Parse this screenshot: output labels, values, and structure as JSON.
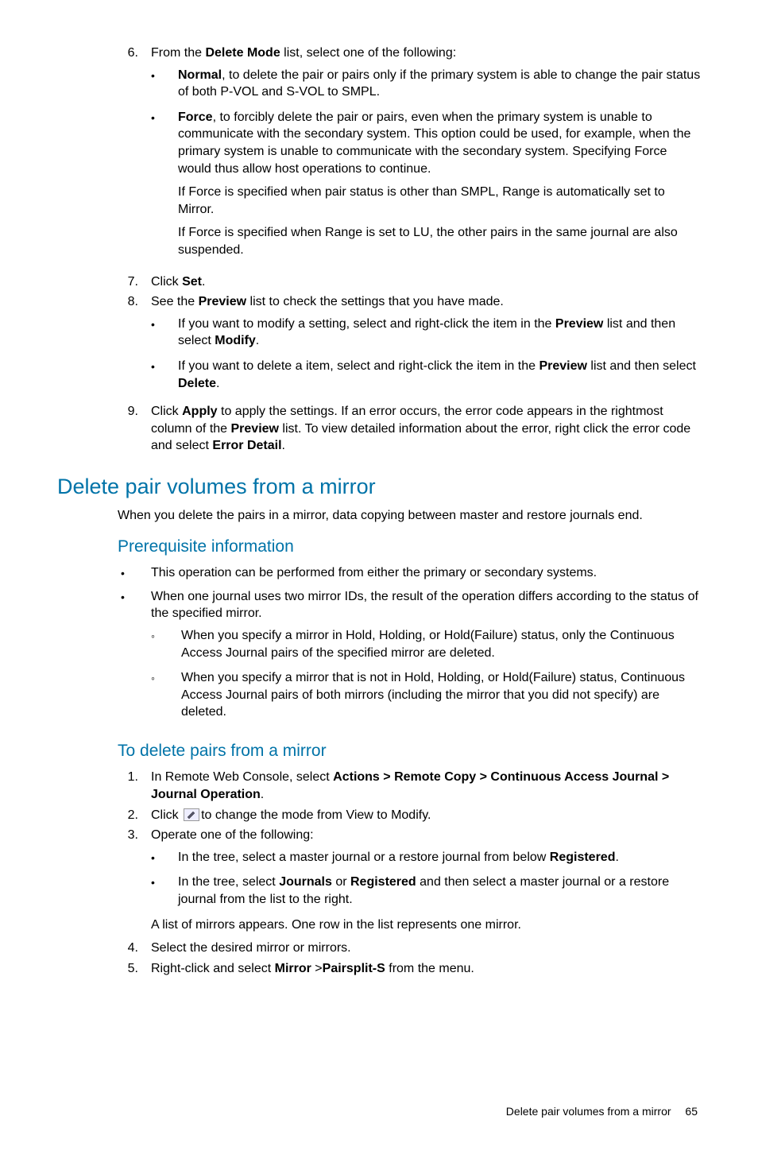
{
  "steps_a": {
    "n6": "6.",
    "s6_lead": "From the ",
    "s6_b": "Delete Mode",
    "s6_tail": " list, select one of the following:",
    "s6_b1_b": "Normal",
    "s6_b1_t": ", to delete the pair or pairs only if the primary system is able to change the pair status of both P-VOL and S-VOL to SMPL.",
    "s6_b2_b": "Force",
    "s6_b2_t": ", to forcibly delete the pair or pairs, even when the primary system is unable to communicate with the secondary system. This option could be used, for example, when the primary system is unable to communicate with the secondary system. Specifying Force would thus allow host operations to continue.",
    "s6_b2_p2": "If Force is specified when pair status is other than SMPL, Range is automatically set to Mirror.",
    "s6_b2_p3": "If Force is specified when Range is set to LU, the other pairs in the same journal are also suspended.",
    "n7": "7.",
    "s7_lead": "Click ",
    "s7_b": "Set",
    "s7_tail": ".",
    "n8": "8.",
    "s8_lead": "See the ",
    "s8_b": "Preview",
    "s8_tail": " list to check the settings that you have made.",
    "s8_b1_a": "If you want to modify a setting, select and right-click the item in the ",
    "s8_b1_b": "Preview",
    "s8_b1_c": " list and then select ",
    "s8_b1_d": "Modify",
    "s8_b1_e": ".",
    "s8_b2_a": "If you want to delete a item, select and right-click the item in the ",
    "s8_b2_b": "Preview",
    "s8_b2_c": " list and then select ",
    "s8_b2_d": "Delete",
    "s8_b2_e": ".",
    "n9": "9.",
    "s9_a": "Click ",
    "s9_b": "Apply",
    "s9_c": " to apply the settings. If an error occurs, the error code appears in the rightmost column of the ",
    "s9_d": "Preview",
    "s9_e": " list. To view detailed information about the error, right click the error code and select ",
    "s9_f": "Error Detail",
    "s9_g": "."
  },
  "h1": "Delete pair volumes from a mirror",
  "intro": "When you delete the pairs in a mirror, data copying between master and restore journals end.",
  "h2a": "Prerequisite information",
  "prereq": {
    "p1": "This operation can be performed from either the primary or secondary systems.",
    "p2": "When one journal uses two mirror IDs, the result of the operation differs according to the status of the specified mirror.",
    "p2s1": "When you specify a mirror in Hold, Holding, or Hold(Failure) status, only the Continuous Access Journal pairs of the specified mirror are deleted.",
    "p2s2": "When you specify a mirror that is not in Hold, Holding, or Hold(Failure) status, Continuous Access Journal pairs of both mirrors (including the mirror that you did not specify) are deleted."
  },
  "h2b": "To delete pairs from a mirror",
  "steps_b": {
    "n1": "1.",
    "s1_a": "In Remote Web Console, select ",
    "s1_b": "Actions > Remote Copy > Continuous Access Journal > Journal Operation",
    "s1_c": ".",
    "n2": "2.",
    "s2_a": "Click ",
    "s2_b": "to change the mode from View to Modify.",
    "n3": "3.",
    "s3": "Operate one of the following:",
    "s3_b1_a": "In the tree, select a master journal or a restore journal from below ",
    "s3_b1_b": "Registered",
    "s3_b1_c": ".",
    "s3_b2_a": "In the tree, select ",
    "s3_b2_b": "Journals",
    "s3_b2_c": " or ",
    "s3_b2_d": "Registered",
    "s3_b2_e": " and then select a master journal or a restore journal from the list to the right.",
    "s3_after": "A list of mirrors appears. One row in the list represents one mirror.",
    "n4": "4.",
    "s4": "Select the desired mirror or mirrors.",
    "n5": "5.",
    "s5_a": "Right-click and select ",
    "s5_b": "Mirror",
    "s5_c": " >",
    "s5_d": "Pairsplit-S",
    "s5_e": " from the menu."
  },
  "footer": {
    "title": "Delete pair volumes from a mirror",
    "page": "65"
  }
}
